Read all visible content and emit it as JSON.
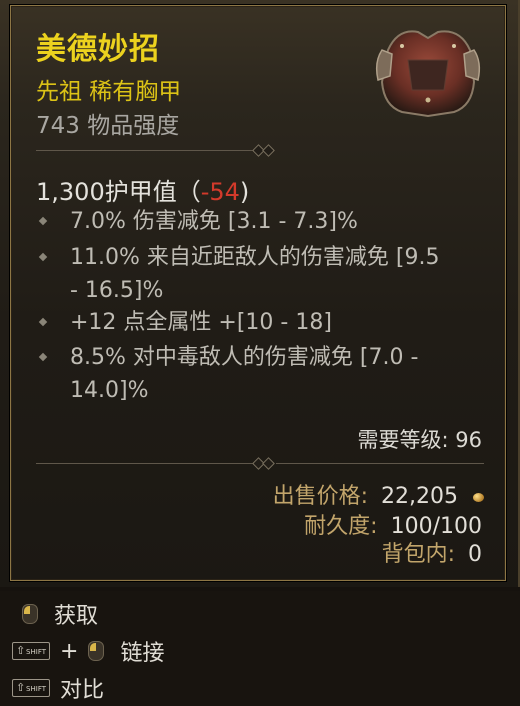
{
  "item": {
    "name": "美德妙招",
    "type": "先祖 稀有胸甲",
    "power": "743 物品强度",
    "image_icon": "chest-armor-image"
  },
  "armor": {
    "value": "1,300护甲值",
    "open_paren": "（",
    "diff": "-54",
    "close_paren": ")"
  },
  "affixes": [
    {
      "text": "7.0% 伤害减免 [3.1 - 7.3]%"
    },
    {
      "text": "11.0% 来自近距敌人的伤害减免 [9.5 - 16.5]%"
    },
    {
      "text": "+12 点全属性 +[10 - 18]"
    },
    {
      "text": "8.5% 对中毒敌人的伤害减免 [7.0 - 14.0]%"
    }
  ],
  "requirements": {
    "level": "需要等级: 96"
  },
  "sell": {
    "label": "出售价格:",
    "value": "22,205"
  },
  "durability": {
    "label": "耐久度:",
    "value": "100/100"
  },
  "bag": {
    "label": "背包内:",
    "value": "0"
  },
  "prompts": {
    "acquire": "获取",
    "link_plus": "+",
    "link": "链接",
    "compare": "对比",
    "shift_label": "SHIFT"
  },
  "colors": {
    "title": "#ecd21e",
    "subtype": "#dcc316",
    "negative": "#d33a2b",
    "sell_label": "#c2a56b"
  }
}
